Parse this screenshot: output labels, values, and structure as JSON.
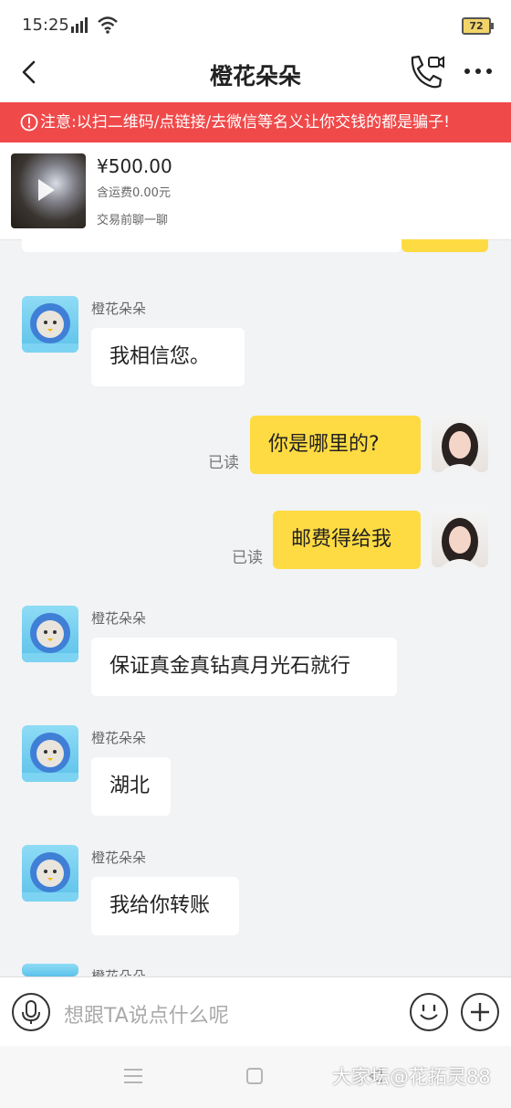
{
  "status_bar": {
    "time": "15:25",
    "network": "4G",
    "battery": "72"
  },
  "header": {
    "title": "橙花朵朵"
  },
  "warning": {
    "text": "注意:以扫二维码/点链接/去微信等名义让你交钱的都是骗子!"
  },
  "product": {
    "price": "¥500.00",
    "shipping": "含运费0.00元",
    "tip": "交易前聊一聊"
  },
  "messages": [
    {
      "side": "left",
      "sender": "橙花朵朵",
      "text": "我相信您。"
    },
    {
      "side": "right",
      "read": "已读",
      "text": "你是哪里的?"
    },
    {
      "side": "right",
      "read": "已读",
      "text": "邮费得给我"
    },
    {
      "side": "left",
      "sender": "橙花朵朵",
      "text": "保证真金真钻真月光石就行"
    },
    {
      "side": "left",
      "sender": "橙花朵朵",
      "text": "湖北"
    },
    {
      "side": "left",
      "sender": "橙花朵朵",
      "text": "我给你转账"
    },
    {
      "side": "left",
      "sender": "橙花朵朵",
      "text": ""
    }
  ],
  "input": {
    "placeholder": "想跟TA说点什么呢"
  },
  "watermark": "大家坛@花拓灵88"
}
